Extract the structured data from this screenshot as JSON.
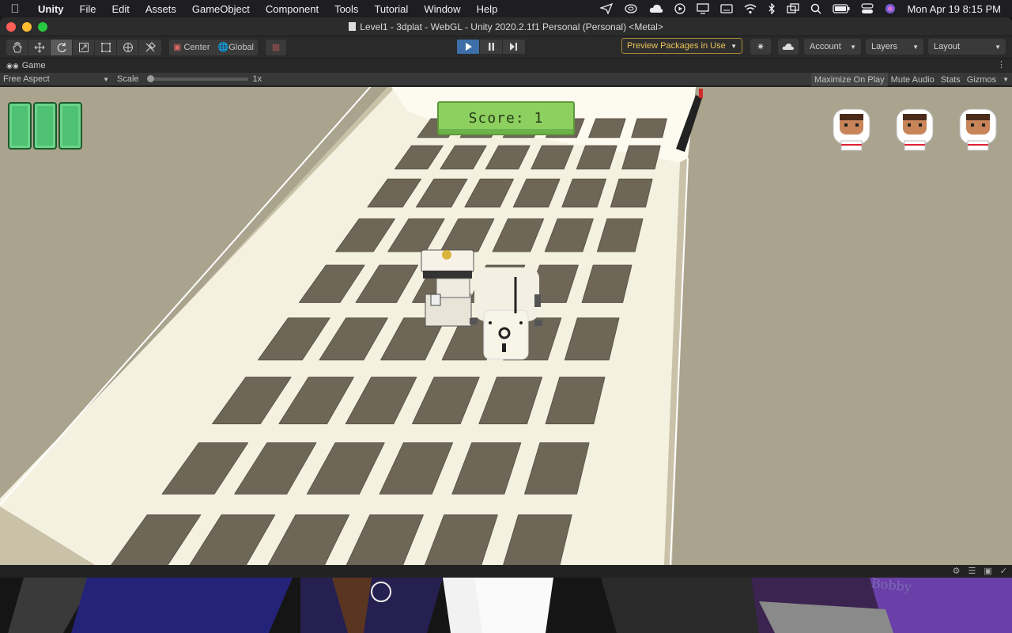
{
  "menubar": {
    "app": "Unity",
    "items": [
      "File",
      "Edit",
      "Assets",
      "GameObject",
      "Component",
      "Tools",
      "Tutorial",
      "Window",
      "Help"
    ],
    "clock": "Mon Apr 19  8:15 PM",
    "status_icons": [
      "send-icon",
      "creative-cloud-icon",
      "cloud-upload-icon",
      "play-circle-icon",
      "display-icon",
      "keyboard-icon",
      "wifi-icon",
      "bluetooth-icon",
      "screen-mirror-icon",
      "search-icon",
      "battery-icon",
      "control-center-icon",
      "siri-icon"
    ]
  },
  "window": {
    "title": "Level1 - 3dplat - WebGL - Unity 2020.2.1f1 Personal (Personal) <Metal>"
  },
  "toolbar": {
    "tools": [
      "hand-icon",
      "move-icon",
      "rotate-icon",
      "scale-icon",
      "rect-tool-icon",
      "transform-tool-icon",
      "custom-tool-icon"
    ],
    "pivot_center": "Center",
    "pivot_global": "Global",
    "packages_label": "Preview Packages in Use",
    "account_label": "Account",
    "layers_label": "Layers",
    "layout_label": "Layout"
  },
  "game_tab": {
    "label": "Game"
  },
  "game_bar": {
    "aspect": "Free Aspect",
    "scale_label": "Scale",
    "scale_value": "1x",
    "maximize": "Maximize On Play",
    "mute": "Mute Audio",
    "stats": "Stats",
    "gizmos": "Gizmos"
  },
  "hud": {
    "score_text": "Score: 1",
    "health_bars": 3,
    "lives": 3
  },
  "desktop": {
    "label": "Bobby"
  },
  "colors": {
    "menubar_bg": "#1e1e22",
    "window_bg": "#282828",
    "play_active": "#3e6ea8",
    "hud_green": "#4fc172",
    "score_green": "#8ed05f",
    "floor": "#f5f2e4",
    "tile": "#6e6657"
  }
}
